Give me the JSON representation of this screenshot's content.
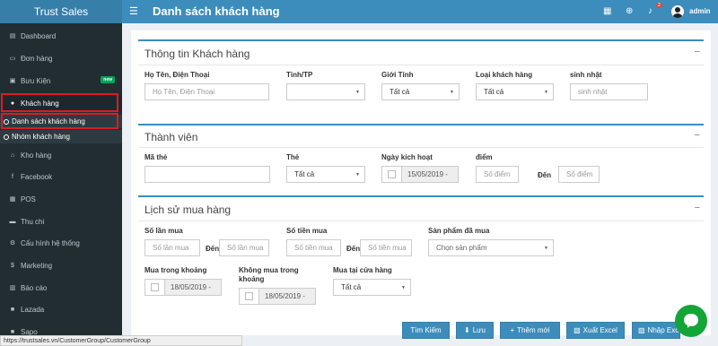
{
  "app": {
    "brand": "Trust Sales",
    "title": "Danh sách khách hàng"
  },
  "topbar": {
    "notif_count": "2",
    "user": "admin"
  },
  "sidebar": {
    "items": [
      {
        "label": "Dashboard",
        "icon": "dashboard-icon"
      },
      {
        "label": "Đơn hàng",
        "icon": "cart-icon"
      },
      {
        "label": "Bưu Kiện",
        "icon": "box-icon",
        "badge": "new"
      },
      {
        "label": "Khách hàng",
        "icon": "users-icon"
      },
      {
        "label": "Kho hàng",
        "icon": "warehouse-icon"
      },
      {
        "label": "Facebook",
        "icon": "facebook-icon"
      },
      {
        "label": "POS",
        "icon": "pos-icon"
      },
      {
        "label": "Thu chi",
        "icon": "money-icon"
      },
      {
        "label": "Cấu hình hệ thống",
        "icon": "cogs-icon"
      },
      {
        "label": "Marketing",
        "icon": "dollar-icon"
      },
      {
        "label": "Báo cáo",
        "icon": "report-icon"
      },
      {
        "label": "Lazada",
        "icon": "lazada-icon"
      },
      {
        "label": "Sapo",
        "icon": "sapo-icon"
      }
    ],
    "subitems": [
      {
        "label": "Danh sách khách hàng"
      },
      {
        "label": "Nhóm khách hàng"
      }
    ]
  },
  "customer_info": {
    "title": "Thông tin Khách hàng",
    "name_label": "Họ Tên, Điện Thoại",
    "name_placeholder": "Họ Tên, Điện Thoại",
    "province_label": "Tỉnh/TP",
    "province_value": "",
    "gender_label": "Giới Tính",
    "gender_value": "Tất cả",
    "type_label": "Loại khách hàng",
    "type_value": "Tất cả",
    "birthday_label": "sinh nhật",
    "birthday_placeholder": "sinh nhật"
  },
  "member": {
    "title": "Thành viên",
    "card_no_label": "Mã thẻ",
    "card_label": "Thẻ",
    "card_value": "Tất cả",
    "activation_label": "Ngày kích hoạt",
    "activation_date": "15/05/2019 -",
    "points_label": "điểm",
    "points_from_placeholder": "Số điểm",
    "to_label": "Đến",
    "points_to_placeholder": "Số điểm"
  },
  "purchase": {
    "title": "Lịch sử mua hàng",
    "times_label": "Số lần mua",
    "times_from_placeholder": "Số lần mua",
    "to_label": "Đến",
    "times_to_placeholder": "Số lần mua",
    "amount_label": "Số tiền mua",
    "amount_from_placeholder": "Số tiền mua",
    "amount_to_placeholder": "Số tiền mua",
    "product_label": "Sản phẩm đã mua",
    "product_value": "Chọn sản phẩm",
    "bought_in_label": "Mua trong khoảng",
    "bought_in_date": "18/05/2019 -",
    "not_bought_label_1": "Không mua trong",
    "not_bought_label_2": "khoảng",
    "not_bought_date": "18/05/2019 -",
    "store_label": "Mua tại cửa hàng",
    "store_value": "Tất cả"
  },
  "actions": {
    "search": "Tìm Kiếm",
    "save": "Lưu",
    "add": "Thêm mới",
    "export": "Xuất Excel",
    "import": "Nhập Exc"
  },
  "status_url": "https://trustsales.vn/CustomerGroup/CustomerGroup",
  "colors": {
    "primary": "#3c8dbc",
    "sidebar": "#222d32",
    "highlight": "#dd1b23",
    "chat": "#13a538"
  }
}
